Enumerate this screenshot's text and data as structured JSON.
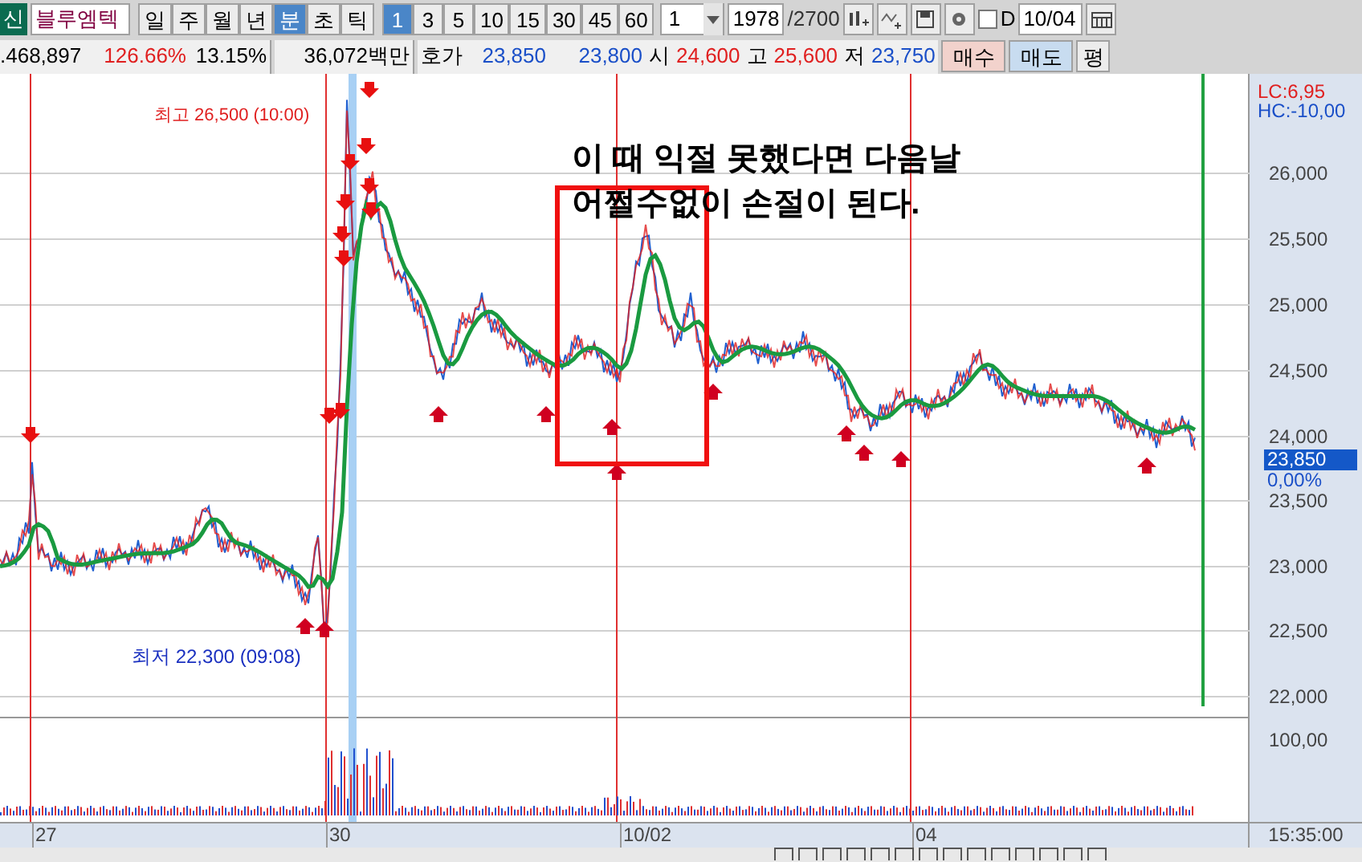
{
  "toolbar": {
    "market_badge": "신",
    "stock_name": "블루엠텍",
    "period_tabs": [
      {
        "label": "일",
        "selected": false
      },
      {
        "label": "주",
        "selected": false
      },
      {
        "label": "월",
        "selected": false
      },
      {
        "label": "년",
        "selected": false
      },
      {
        "label": "분",
        "selected": true
      },
      {
        "label": "초",
        "selected": false
      },
      {
        "label": "틱",
        "selected": false
      }
    ],
    "interval_tabs": [
      {
        "label": "1",
        "selected": true
      },
      {
        "label": "3",
        "selected": false
      },
      {
        "label": "5",
        "selected": false
      },
      {
        "label": "10",
        "selected": false
      },
      {
        "label": "15",
        "selected": false
      },
      {
        "label": "30",
        "selected": false
      },
      {
        "label": "45",
        "selected": false
      },
      {
        "label": "60",
        "selected": false
      }
    ],
    "interval_select": "1",
    "count": "1978",
    "total": "/2700",
    "d_checkbox": {
      "label": "D",
      "checked": false
    },
    "date": "10/04"
  },
  "quote_bar": {
    "volume": ".468,897",
    "change_rate": "126.66%",
    "turnover": "13.15%",
    "amount": "36,072백만",
    "ask_label": "호가",
    "ask_1": "23,850",
    "ask_2": "23,800",
    "open_label": "시",
    "open": "24,600",
    "high_label": "고",
    "high": "25,600",
    "low_label": "저",
    "low": "23,750",
    "buy_button": "매수",
    "sell_button": "매도",
    "avg_button": "평"
  },
  "chart": {
    "high_note": "최고 26,500 (10:00)",
    "low_note": "최저 22,300 (09:08)",
    "callout": [
      "이 때 익절 못했다면 다음날",
      "어쩔수없이 손절이 된다."
    ],
    "lc": "LC:6,95",
    "hc": "HC:-10,00",
    "price_ticks": [
      "26,000",
      "25,500",
      "25,000",
      "24,500",
      "24,000",
      "23,500",
      "23,000",
      "22,500",
      "22,000"
    ],
    "current_price": "23,850",
    "current_change": "0,00%",
    "volume_tick": "100,00",
    "dates": [
      "27",
      "30",
      "10/02",
      "04"
    ],
    "time": "15:35:00"
  }
}
